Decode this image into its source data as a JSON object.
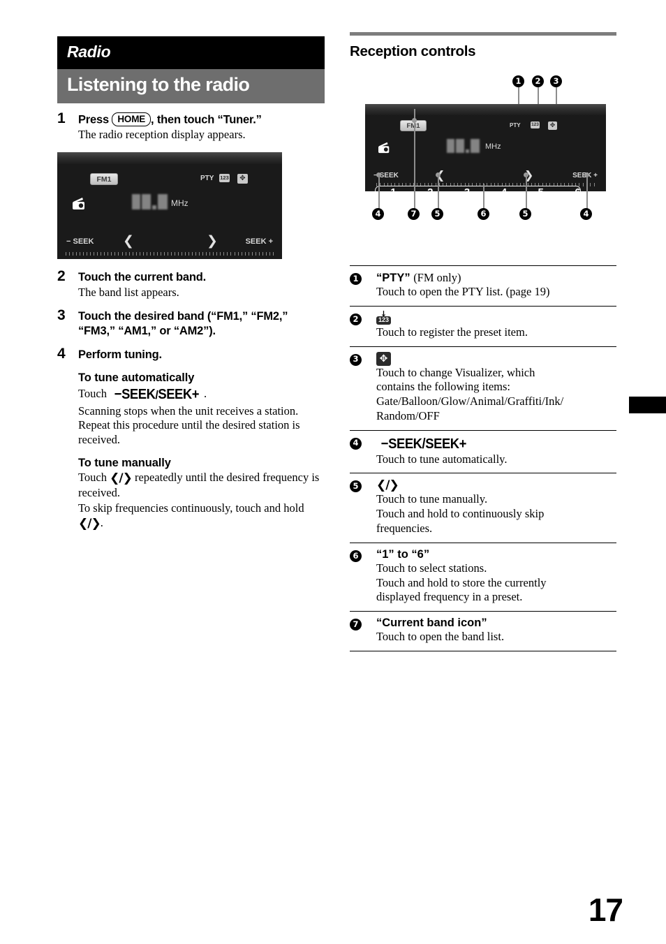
{
  "chapter": {
    "title": "Radio"
  },
  "section": {
    "title": "Listening to the radio"
  },
  "steps": [
    {
      "num": "1",
      "head_before": "Press ",
      "button": "HOME",
      "head_after": ", then touch “Tuner.”",
      "body": "The radio reception display appears."
    },
    {
      "num": "2",
      "head": "Touch the current band.",
      "body": "The band list appears."
    },
    {
      "num": "3",
      "head": "Touch the desired band (“FM1,” “FM2,” “FM3,” “AM1,” or “AM2”)."
    },
    {
      "num": "4",
      "head": "Perform tuning."
    }
  ],
  "tune_auto": {
    "heading": "To tune automatically",
    "touch_label": "Touch",
    "glyph_minus": "−",
    "glyph_seek": "SEEK",
    "glyph_slash": "/",
    "glyph_seek2": "SEEK",
    "glyph_plus": "+",
    "period": ".",
    "body": "Scanning stops when the unit receives a station. Repeat this procedure until the desired station is received."
  },
  "tune_manual": {
    "heading": "To tune manually",
    "line1_before": "Touch",
    "arrow_glyph": "❮/❯",
    "line1_after": "repeatedly until the desired frequency is received.",
    "line2_before": "To skip frequencies continuously, touch and hold",
    "line2_after": "."
  },
  "device_screen": {
    "band_button": "FM1",
    "pty_label": "PTY",
    "icon_123": "123",
    "icon_visualizer": "✥",
    "radio_icon": "radio-icon",
    "frequency_display": "87.5",
    "frequency_unit": "MHz",
    "seek_minus": "− SEEK",
    "seek_plus": "SEEK +",
    "arrow_left": "❮",
    "arrow_right": "❯",
    "presets": [
      "1",
      "2",
      "3",
      "4",
      "5",
      "6"
    ]
  },
  "reception": {
    "title": "Reception controls",
    "callouts_top": [
      "1",
      "2",
      "3"
    ],
    "callouts_bottom": [
      "4",
      "7",
      "5",
      "6",
      "5",
      "4"
    ]
  },
  "legend": [
    {
      "num": "1",
      "head_bold": "“PTY”",
      "head_plain": "(FM only)",
      "lines": [
        "Touch to open the PTY list. (page 19)"
      ]
    },
    {
      "num": "2",
      "icon": "123",
      "icon_name": "register-preset-icon",
      "lines": [
        "Touch to register the preset item."
      ]
    },
    {
      "num": "3",
      "icon": "✥",
      "icon_name": "visualizer-icon",
      "lines": [
        "Touch to change Visualizer, which",
        "contains the following items:",
        "Gate/Balloon/Glow/Animal/Graffiti/Ink/",
        "Random/OFF"
      ]
    },
    {
      "num": "4",
      "head_seek": "−SEEK/SEEK+",
      "lines": [
        "Touch to tune automatically."
      ]
    },
    {
      "num": "5",
      "head_arrow": "❮/❯",
      "lines": [
        "Touch to tune manually.",
        "Touch and hold to continuously skip",
        "frequencies."
      ]
    },
    {
      "num": "6",
      "head_bold": "“1” to “6”",
      "lines": [
        "Touch to select stations.",
        "Touch and hold to store the currently",
        "displayed frequency in a preset."
      ]
    },
    {
      "num": "7",
      "head_bold": "“Current band icon”",
      "lines": [
        "Touch to open the band list."
      ]
    }
  ],
  "page_number": "17"
}
